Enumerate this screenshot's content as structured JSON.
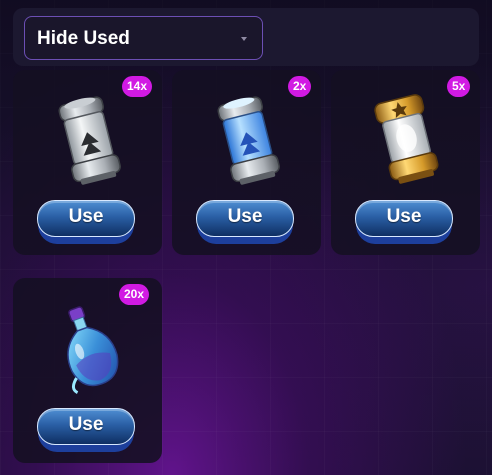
{
  "filter": {
    "selected": "Hide Used"
  },
  "items": [
    {
      "count": "14x",
      "button_label": "Use",
      "icon": "silver-canister-icon"
    },
    {
      "count": "2x",
      "button_label": "Use",
      "icon": "blue-canister-icon"
    },
    {
      "count": "5x",
      "button_label": "Use",
      "icon": "gold-star-canister-icon"
    },
    {
      "count": "20x",
      "button_label": "Use",
      "icon": "blue-potion-bottle-icon"
    }
  ],
  "colors": {
    "badge": "#d11ae3",
    "button_top": "#4f8fd3",
    "button_bottom": "#0f2f63",
    "filter_border": "#6c4fb4"
  }
}
